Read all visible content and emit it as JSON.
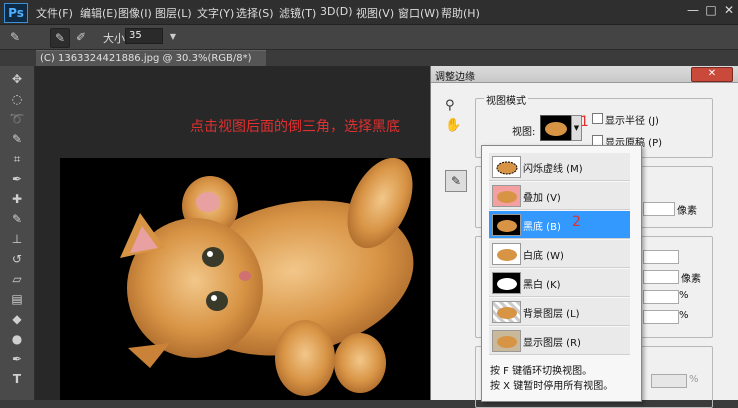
{
  "menubar": {
    "logo": "Ps",
    "items": [
      "文件(F)",
      "编辑(E)",
      "图像(I)",
      "图层(L)",
      "文字(Y)",
      "选择(S)",
      "滤镜(T)",
      "3D(D)",
      "视图(V)",
      "窗口(W)",
      "帮助(H)"
    ],
    "minimize": "—",
    "restore": "□",
    "close": "✕"
  },
  "options": {
    "size_label": "大小:",
    "size_value": "35"
  },
  "document": {
    "tab_title": "(C) 1363324421886.jpg @ 30.3%(RGB/8*)"
  },
  "annotation": {
    "text": "点击视图后面的倒三角，选择黑底",
    "mark1": "1",
    "mark2": "2"
  },
  "dialog": {
    "title": "调整边缘",
    "close_label": "✕",
    "view_mode_legend": "视图模式",
    "view_label": "视图:",
    "show_radius": "显示半径 (J)",
    "show_original": "显示原稿 (P)",
    "unit_px": "像素",
    "unit_percent": "%"
  },
  "view_options": [
    {
      "label": "闪烁虚线 (M)",
      "thumb": "marching"
    },
    {
      "label": "叠加 (V)",
      "thumb": "overlay"
    },
    {
      "label": "黑底 (B)",
      "thumb": "black",
      "selected": true
    },
    {
      "label": "白底 (W)",
      "thumb": "white"
    },
    {
      "label": "黑白 (K)",
      "thumb": "bw"
    },
    {
      "label": "背景图层 (L)",
      "thumb": "layer"
    },
    {
      "label": "显示图层 (R)",
      "thumb": "reveal"
    }
  ],
  "hints": {
    "line1": "按 F 键循环切换视图。",
    "line2": "按 X 键暂时停用所有视图。"
  },
  "colors": {
    "selected": "#3399ff",
    "annotation": "#e03030"
  }
}
